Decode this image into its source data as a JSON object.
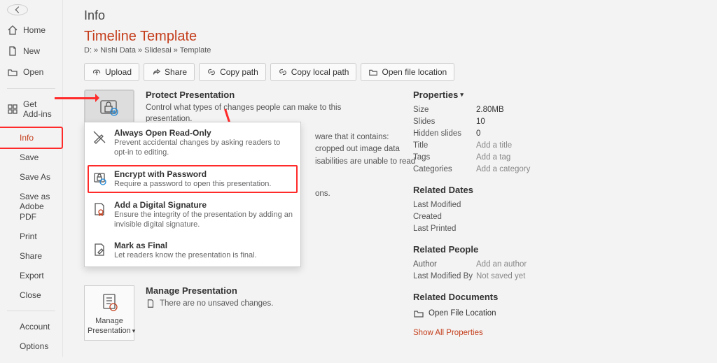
{
  "sidebar": {
    "items": [
      {
        "label": "Home"
      },
      {
        "label": "New"
      },
      {
        "label": "Open"
      },
      {
        "label": "Get Add-ins"
      },
      {
        "label": "Info"
      },
      {
        "label": "Save"
      },
      {
        "label": "Save As"
      },
      {
        "label": "Save as Adobe PDF"
      },
      {
        "label": "Print"
      },
      {
        "label": "Share"
      },
      {
        "label": "Export"
      },
      {
        "label": "Close"
      }
    ],
    "bottom": [
      {
        "label": "Account"
      },
      {
        "label": "Options"
      }
    ]
  },
  "page": {
    "title": "Info",
    "doc_title": "Timeline Template",
    "doc_path": "D: » Nishi Data » Slidesai » Template"
  },
  "toolbar": {
    "upload": "Upload",
    "share": "Share",
    "copy_path": "Copy path",
    "copy_local": "Copy local path",
    "open_loc": "Open file location"
  },
  "protect": {
    "btn": "Protect Presentation",
    "title": "Protect Presentation",
    "desc": "Control what types of changes people can make to this presentation."
  },
  "dropdown": [
    {
      "title": "Always Open Read-Only",
      "desc": "Prevent accidental changes by asking readers to opt-in to editing."
    },
    {
      "title": "Encrypt with Password",
      "desc": "Require a password to open this presentation."
    },
    {
      "title": "Add a Digital Signature",
      "desc": "Ensure the integrity of the presentation by adding an invisible digital signature."
    },
    {
      "title": "Mark as Final",
      "desc": "Let readers know the presentation is final."
    }
  ],
  "inspect_leak": {
    "l1": "ware that it contains:",
    "l2": "cropped out image data",
    "l3": "isabilities are unable to read"
  },
  "history_leak": "ons.",
  "manage": {
    "btn": "Manage Presentation",
    "title": "Manage Presentation",
    "desc": "There are no unsaved changes."
  },
  "props": {
    "heading": "Properties",
    "rows": {
      "size_k": "Size",
      "size_v": "2.80MB",
      "slides_k": "Slides",
      "slides_v": "10",
      "hidden_k": "Hidden slides",
      "hidden_v": "0",
      "title_k": "Title",
      "title_v": "Add a title",
      "tags_k": "Tags",
      "tags_v": "Add a tag",
      "cat_k": "Categories",
      "cat_v": "Add a category"
    },
    "dates_h": "Related Dates",
    "dates": {
      "lm_k": "Last Modified",
      "cr_k": "Created",
      "lp_k": "Last Printed"
    },
    "people_h": "Related People",
    "people": {
      "auth_k": "Author",
      "auth_v": "Add an author",
      "lmb_k": "Last Modified By",
      "lmb_v": "Not saved yet"
    },
    "docs_h": "Related Documents",
    "open_loc": "Open File Location",
    "show_all": "Show All Properties"
  }
}
